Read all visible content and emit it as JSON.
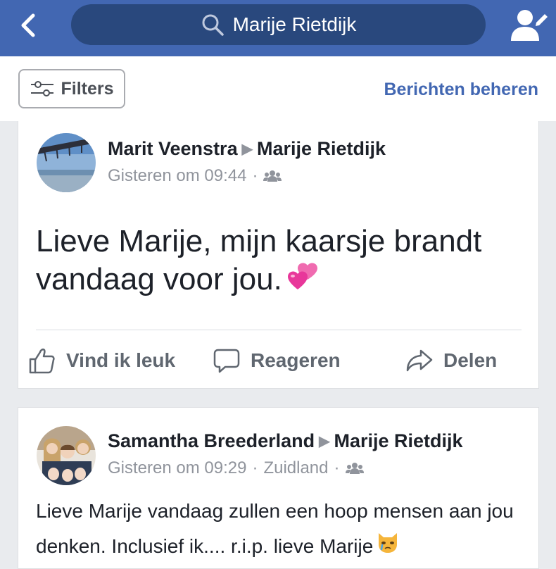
{
  "header": {
    "search_value": "Marije Rietdijk",
    "bg_color": "#4267b2",
    "pill_color": "#29487d"
  },
  "filterbar": {
    "filters_label": "Filters",
    "manage_label": "Berichten beheren"
  },
  "posts": [
    {
      "author": "Marit Veenstra",
      "arrow": "▶",
      "target": "Marije Rietdijk",
      "time": "Gisteren om 09:44",
      "dot": "·",
      "location": "",
      "privacy_icon": "friends-icon",
      "text": "Lieve Marije, mijn kaarsje brandt vandaag voor jou.",
      "emoji": "two-hearts-emoji",
      "actions": {
        "like": "Vind ik leuk",
        "comment": "Reageren",
        "share": "Delen"
      }
    },
    {
      "author": "Samantha Breederland",
      "arrow": "▶",
      "target": "Marije Rietdijk",
      "time": "Gisteren om 09:29",
      "dot": "·",
      "location": "Zuidland",
      "dot2": "·",
      "privacy_icon": "friends-icon",
      "text": "Lieve Marije vandaag zullen een hoop mensen aan jou denken. Inclusief ik.... r.i.p. lieve Marije",
      "emoji": "crying-cat-emoji"
    }
  ]
}
